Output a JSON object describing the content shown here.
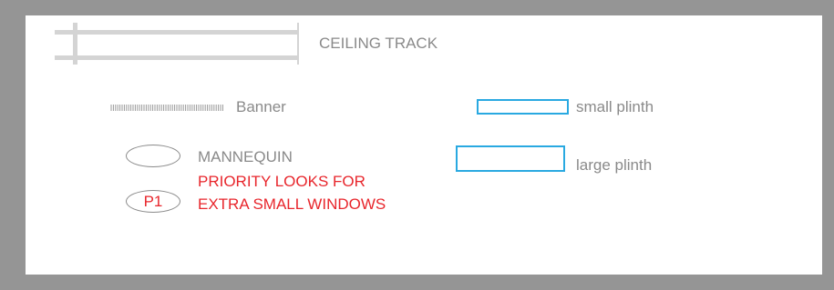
{
  "legend": {
    "ceiling_track_label": "CEILING TRACK",
    "banner_label": "Banner",
    "mannequin_label": "MANNEQUIN",
    "priority_line1": "PRIORITY LOOKS FOR",
    "priority_line2": "EXTRA SMALL WINDOWS",
    "p1_badge": "P1",
    "small_plinth_label": "small plinth",
    "large_plinth_label": "large plinth"
  },
  "colors": {
    "background_frame": "#959595",
    "panel": "#ffffff",
    "label_grey": "#8a8a8a",
    "track_grey": "#d4d4d4",
    "plinth_blue": "#29a9e1",
    "priority_red": "#e8262c",
    "banner_stripe": "#9a9a9a"
  },
  "icons": {
    "ceiling_track": "ceiling-track-icon",
    "banner": "banner-icon",
    "mannequin": "mannequin-icon",
    "p1": "p1-badge-icon",
    "small_plinth": "small-plinth-icon",
    "large_plinth": "large-plinth-icon"
  }
}
